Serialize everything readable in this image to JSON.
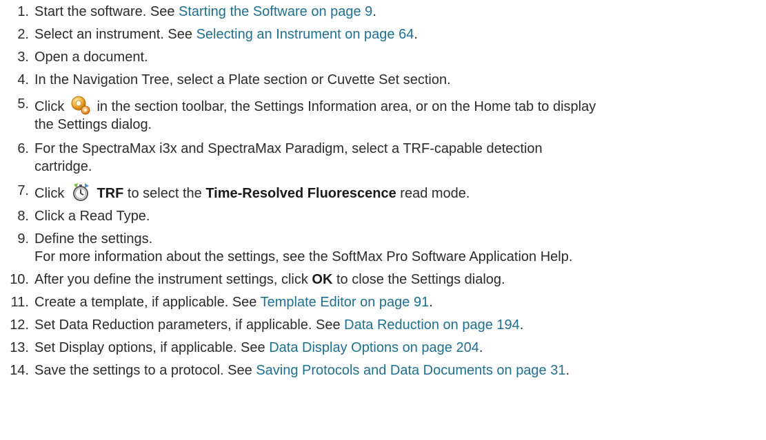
{
  "steps": [
    {
      "n": "1.",
      "pre": "Start the software. See ",
      "link": "Starting the Software on page 9",
      "post": "."
    },
    {
      "n": "2.",
      "pre": "Select an instrument. See ",
      "link": "Selecting an Instrument on page 64",
      "post": "."
    },
    {
      "n": "3.",
      "text": "Open a document."
    },
    {
      "n": "4.",
      "text": "In the Navigation Tree, select a Plate section or Cuvette Set section."
    },
    {
      "n": "5.",
      "pre": "Click",
      "icon": "settings-gear-icon",
      "post": " in the section toolbar, the Settings Information area, or on the Home tab to display",
      "line2": "the Settings dialog."
    },
    {
      "n": "6.",
      "text": "For the SpectraMax i3x and SpectraMax Paradigm, select a TRF-capable detection",
      "line2": "cartridge."
    },
    {
      "n": "7.",
      "pre": "Click",
      "icon": "trf-stopwatch-icon",
      "bold1": "TRF",
      "mid": " to select the ",
      "bold2": "Time-Resolved Fluorescence",
      "post": " read mode."
    },
    {
      "n": "8.",
      "text": "Click a Read Type."
    },
    {
      "n": "9.",
      "text": "Define the settings.",
      "line2": "For more information about the settings, see the SoftMax Pro Software Application Help."
    },
    {
      "n": "10.",
      "pre": "After you define the instrument settings, click ",
      "bold1": "OK",
      "post": " to close the Settings dialog."
    },
    {
      "n": "11.",
      "pre": "Create a template, if applicable. See ",
      "link": "Template Editor on page 91",
      "post": "."
    },
    {
      "n": "12.",
      "pre": "Set Data Reduction parameters, if applicable. See ",
      "link": "Data Reduction on page 194",
      "post": "."
    },
    {
      "n": "13.",
      "pre": "Set Display options, if applicable. See ",
      "link": "Data Display Options on page 204",
      "post": "."
    },
    {
      "n": "14.",
      "pre": "Save the settings to a protocol. See ",
      "link": "Saving Protocols and Data Documents on page 31",
      "post": "."
    }
  ],
  "colors": {
    "link": "#1f6f8f",
    "text": "#2b2b2b"
  }
}
